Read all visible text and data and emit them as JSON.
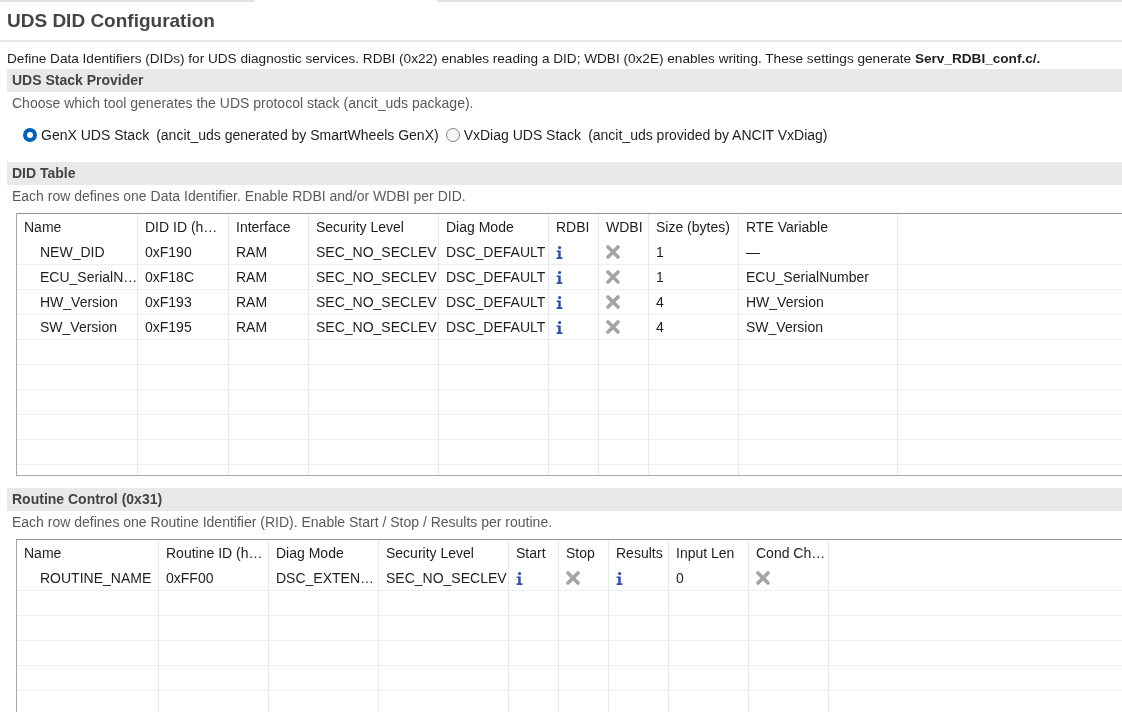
{
  "title": "UDS DID Configuration",
  "description": "Define Data Identifiers (DIDs) for UDS diagnostic services. RDBI (0x22) enables reading a DID; WDBI (0x2E) enables writing. These settings generate **Serv_RDBI_conf.c/.**",
  "stack_provider": {
    "heading": "UDS Stack Provider",
    "hint": "Choose which tool generates the UDS protocol stack (ancit_uds package).",
    "options": [
      {
        "label": "GenX UDS Stack",
        "note": "(ancit_uds generated by SmartWheels GenX)",
        "selected": true
      },
      {
        "label": "VxDiag UDS Stack",
        "note": "(ancit_uds provided by ANCIT VxDiag)",
        "selected": false
      }
    ]
  },
  "did_table": {
    "heading": "DID Table",
    "hint": "Each row defines one Data Identifier. Enable RDBI and/or WDBI per DID.",
    "columns": [
      "Name",
      "DID ID (h…",
      "Interface",
      "Security Level",
      "Diag Mode",
      "RDBI",
      "WDBI",
      "Size (bytes)",
      "RTE Variable"
    ],
    "rows": [
      {
        "cells": [
          "NEW_DID",
          "0xF190",
          "RAM",
          "SEC_NO_SECLEV",
          "DSC_DEFAULT",
          true,
          false,
          "1",
          "—"
        ]
      },
      {
        "cells": [
          "ECU_SerialN…",
          "0xF18C",
          "RAM",
          "SEC_NO_SECLEV",
          "DSC_DEFAULT",
          true,
          false,
          "1",
          "ECU_SerialNumber"
        ]
      },
      {
        "cells": [
          "HW_Version",
          "0xF193",
          "RAM",
          "SEC_NO_SECLEV",
          "DSC_DEFAULT",
          true,
          false,
          "4",
          "HW_Version"
        ]
      },
      {
        "cells": [
          "SW_Version",
          "0xF195",
          "RAM",
          "SEC_NO_SECLEV",
          "DSC_DEFAULT",
          true,
          false,
          "4",
          "SW_Version"
        ]
      }
    ]
  },
  "routine_control": {
    "heading": "Routine Control (0x31)",
    "hint": "Each row defines one Routine Identifier (RID). Enable Start / Stop / Results per routine.",
    "columns": [
      "Name",
      "Routine ID (h…",
      "Diag Mode",
      "Security Level",
      "Start",
      "Stop",
      "Results",
      "Input Len",
      "Cond Ch…"
    ],
    "rows": [
      {
        "cells": [
          "ROUTINE_NAME",
          "0xFF00",
          "DSC_EXTEN…",
          "SEC_NO_SECLEV",
          true,
          false,
          true,
          "0",
          false
        ]
      }
    ]
  }
}
